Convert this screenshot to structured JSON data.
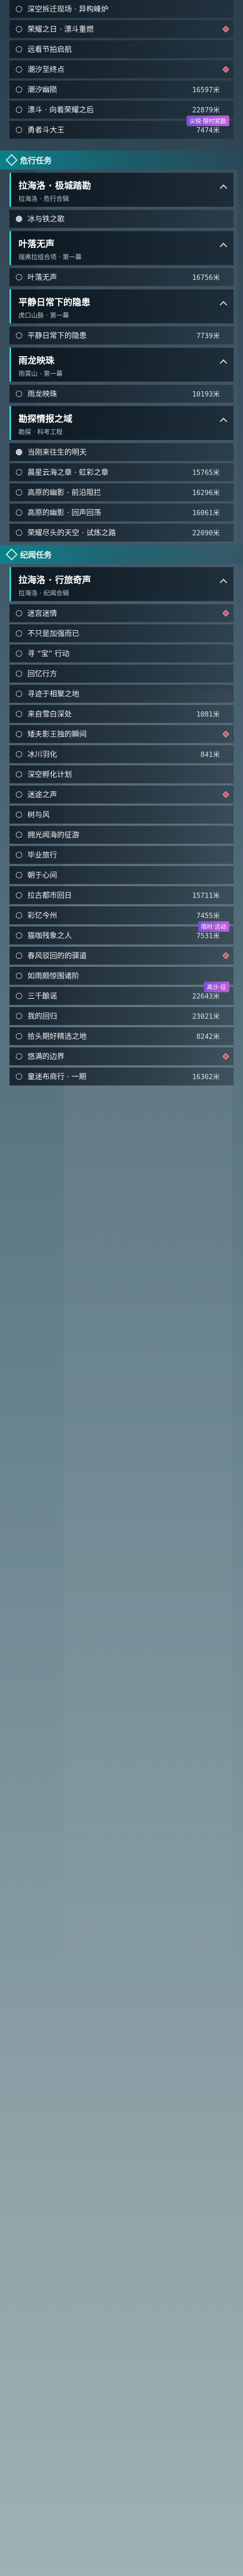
{
  "legendary_block": {
    "rows": [
      {
        "name": "深空拆迁现场 · 异构峰炉",
        "distance": "",
        "done": false,
        "marker": false
      },
      {
        "name": "荣耀之日 · 漂斗重燃",
        "distance": "",
        "done": false,
        "marker": true
      },
      {
        "name": "远看节拍启航",
        "distance": "",
        "done": false,
        "marker": false
      },
      {
        "name": "潮汐至终点",
        "distance": "",
        "done": false,
        "marker": true
      },
      {
        "name": "潮汐幽陨",
        "distance": "16597米",
        "done": false,
        "marker": false
      },
      {
        "name": "漂斗 · 向着荣耀之后",
        "distance": "22879米",
        "done": false,
        "marker": false
      },
      {
        "name": "勇者斗大王",
        "distance": "7474米",
        "done": false,
        "marker": false,
        "badge": "尖锐·限时奖励"
      }
    ]
  },
  "sections": [
    {
      "title": "危行任务",
      "chapters": [
        {
          "title": "拉海洛 · 极城踏勘",
          "subtitle": "拉海洛 · 危行合辑",
          "rows": [
            {
              "name": "冰与铁之歌",
              "distance": "",
              "done": true,
              "marker": false
            }
          ]
        },
        {
          "title": "叶落无声",
          "subtitle": "瑞弗拉组合项 · 第一幕",
          "rows": [
            {
              "name": "叶落无声",
              "distance": "16756米",
              "done": false,
              "marker": false
            }
          ]
        },
        {
          "title": "平静日常下的隐患",
          "subtitle": "虎口山脉 · 第一幕",
          "rows": [
            {
              "name": "平静日常下的隐患",
              "distance": "7739米",
              "done": false,
              "marker": false
            }
          ]
        },
        {
          "title": "雨龙映珠",
          "subtitle": "雨霄山 · 第一幕",
          "rows": [
            {
              "name": "雨龙映珠",
              "distance": "10193米",
              "done": false,
              "marker": false
            }
          ]
        },
        {
          "title": "勘探情报之域",
          "subtitle": "勘探 · 科考工程",
          "rows": [
            {
              "name": "当刚来往生的明天",
              "distance": "",
              "done": true,
              "marker": false
            },
            {
              "name": "晨星云海之章 · 虹彩之章",
              "distance": "15765米",
              "done": false,
              "marker": false
            },
            {
              "name": "高原的幽影 · 前沿阻拦",
              "distance": "16296米",
              "done": false,
              "marker": false
            },
            {
              "name": "高原的幽影 · 回声回荡",
              "distance": "16061米",
              "done": false,
              "marker": false
            },
            {
              "name": "荣耀尽头的天空 · 试炼之路",
              "distance": "22090米",
              "done": false,
              "marker": false
            }
          ]
        }
      ]
    },
    {
      "title": "纪闻任务",
      "chapters": [
        {
          "title": "拉海洛 · 行旅奇声",
          "subtitle": "拉海洛 · 纪闻合辑",
          "rows": [
            {
              "name": "迷宫迷情",
              "distance": "",
              "done": false,
              "marker": true
            },
            {
              "name": "不只是加强而已",
              "distance": "",
              "done": false,
              "marker": false
            },
            {
              "name": "寻 “宝” 行动",
              "distance": "",
              "done": false,
              "marker": false
            },
            {
              "name": "回忆行方",
              "distance": "",
              "done": false,
              "marker": false
            },
            {
              "name": "寻迹于相聚之地",
              "distance": "",
              "done": false,
              "marker": false
            },
            {
              "name": "来自雪白深处",
              "distance": "1081米",
              "done": false,
              "marker": false
            },
            {
              "name": "矮夫影王独的瞬间",
              "distance": "",
              "done": false,
              "marker": true
            },
            {
              "name": "冰川羽化",
              "distance": "841米",
              "done": false,
              "marker": false
            },
            {
              "name": "深空孵化计划",
              "distance": "",
              "done": false,
              "marker": false
            },
            {
              "name": "迷途之声",
              "distance": "",
              "done": false,
              "marker": true
            },
            {
              "name": "树与风",
              "distance": "",
              "done": false,
              "marker": false
            },
            {
              "name": "拥光闻海的征游",
              "distance": "",
              "done": false,
              "marker": false
            },
            {
              "name": "毕业旅行",
              "distance": "",
              "done": false,
              "marker": false
            },
            {
              "name": "朝于心间",
              "distance": "",
              "done": false,
              "marker": false
            },
            {
              "name": "拉古都市回日",
              "distance": "15711米",
              "done": false,
              "marker": false
            },
            {
              "name": "彩忆今州",
              "distance": "7455米",
              "done": false,
              "marker": false
            },
            {
              "name": "猫咖残象之人",
              "distance": "7531米",
              "done": false,
              "marker": false,
              "badge": "限时·活动"
            },
            {
              "name": "春风驳回的的驿道",
              "distance": "",
              "done": false,
              "marker": true
            },
            {
              "name": "如雨颇惊围诸阶",
              "distance": "",
              "done": false,
              "marker": false
            },
            {
              "name": "三千酿谣",
              "distance": "22643米",
              "done": false,
              "marker": false,
              "badge": "高沙·征"
            },
            {
              "name": "我的回归",
              "distance": "23021米",
              "done": false,
              "marker": false
            },
            {
              "name": "拾头期好精选之地",
              "distance": "8242米",
              "done": false,
              "marker": false
            },
            {
              "name": "悠满的边界",
              "distance": "",
              "done": false,
              "marker": true
            },
            {
              "name": "童迷布商行 · 一期",
              "distance": "16362米",
              "done": false,
              "marker": false
            }
          ]
        }
      ]
    }
  ],
  "repeat_rows": [
    {
      "name": "勇者斗大王",
      "distance": "7474米",
      "done": false,
      "marker": false,
      "badge": "尖锐·限时奖励"
    }
  ],
  "colors": {
    "accent": "#0a828c",
    "marker": "#c9566a",
    "badge": "#7b4fd1"
  }
}
